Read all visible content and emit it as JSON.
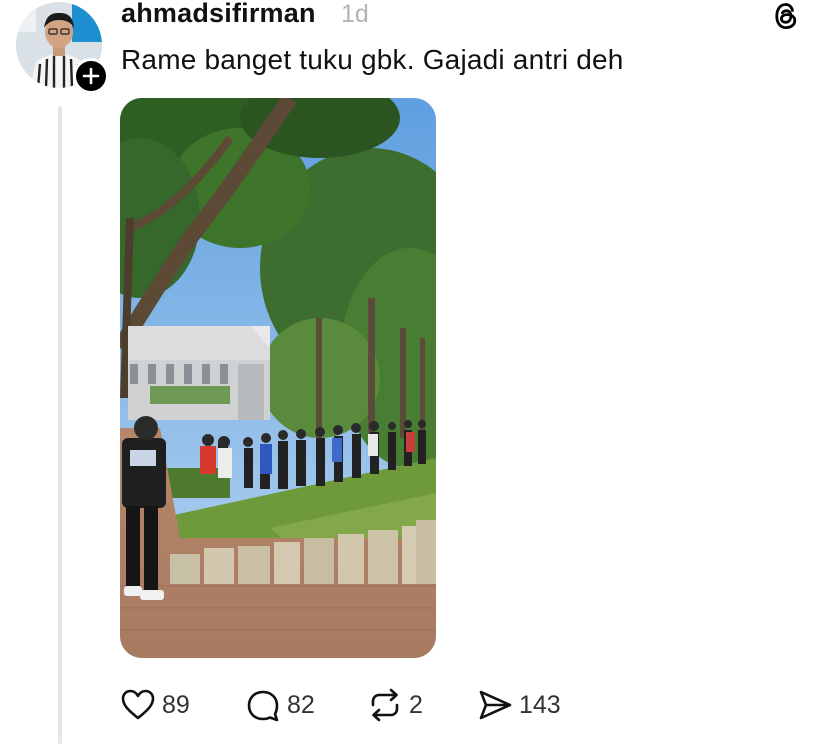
{
  "post": {
    "username": "ahmadsifirman",
    "timestamp": "1d",
    "text": "Rame banget tuku gbk. Gajadi antri deh"
  },
  "actions": {
    "likes": "89",
    "replies": "82",
    "reposts": "2",
    "shares": "143"
  },
  "icons": {
    "avatar_follow": "plus-icon",
    "app_logo": "threads-logo-icon",
    "like": "heart-icon",
    "reply": "comment-bubble-icon",
    "repost": "repost-icon",
    "share": "send-icon"
  }
}
